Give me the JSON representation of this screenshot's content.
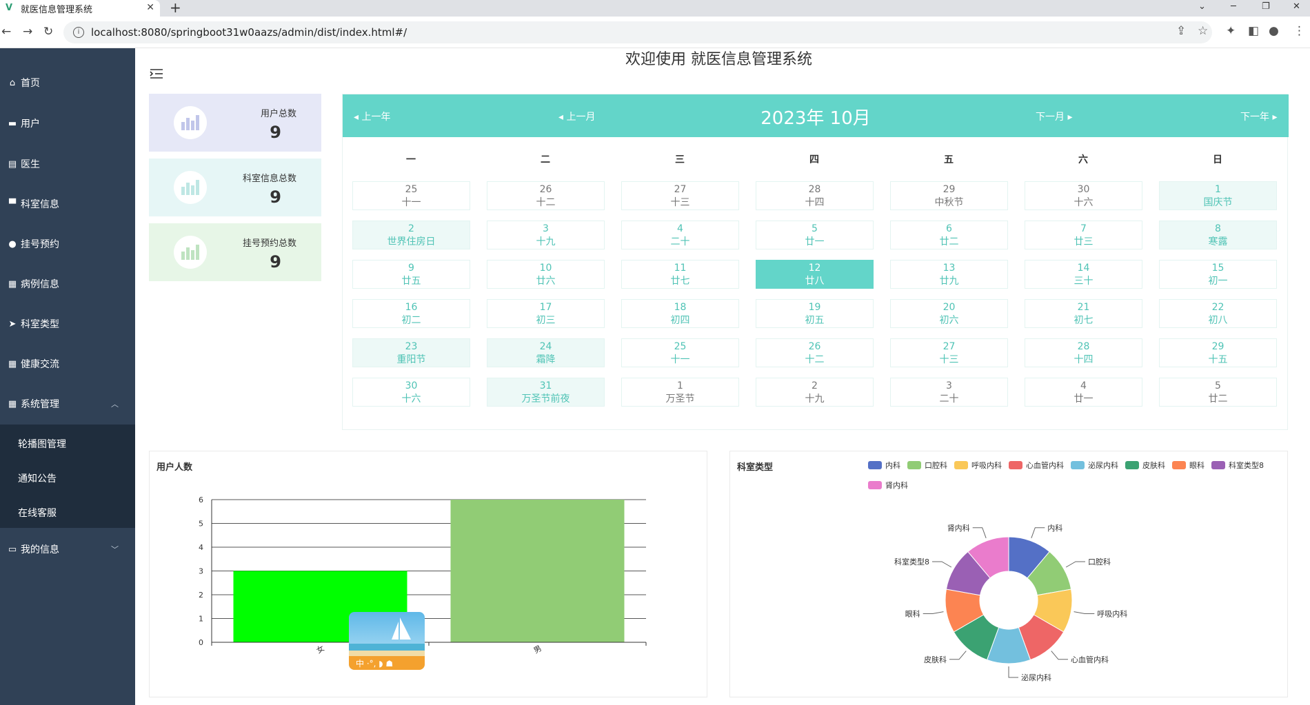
{
  "browser": {
    "tab_title": "就医信息管理系统",
    "url": "localhost:8080/springboot31w0aazs/admin/dist/index.html#/"
  },
  "header": {
    "title": "欢迎使用 就医信息管理系统"
  },
  "sidebar": {
    "items": [
      {
        "label": "首页",
        "icon": "home-icon"
      },
      {
        "label": "用户",
        "icon": "user-icon"
      },
      {
        "label": "医生",
        "icon": "doctor-icon"
      },
      {
        "label": "科室信息",
        "icon": "monitor-icon"
      },
      {
        "label": "挂号预约",
        "icon": "location-icon"
      },
      {
        "label": "病例信息",
        "icon": "grid-icon"
      },
      {
        "label": "科室类型",
        "icon": "send-icon"
      },
      {
        "label": "健康交流",
        "icon": "grid-icon"
      },
      {
        "label": "系统管理",
        "icon": "grid-icon"
      }
    ],
    "submenu": [
      "轮播图管理",
      "通知公告",
      "在线客服"
    ],
    "last_item": {
      "label": "我的信息",
      "icon": "profile-icon"
    }
  },
  "stats": [
    {
      "label": "用户总数",
      "value": "9",
      "bg": "#e6e8f7",
      "icon_color": "#c1c6ea"
    },
    {
      "label": "科室信息总数",
      "value": "9",
      "bg": "#e6f6f6",
      "icon_color": "#bfe7e4"
    },
    {
      "label": "挂号预约总数",
      "value": "9",
      "bg": "#e7f6e7",
      "icon_color": "#bfe3c1"
    }
  ],
  "calendar": {
    "title": "2023年 10月",
    "prev_year": "上一年",
    "prev_month": "上一月",
    "next_month": "下一月",
    "next_year": "下一年",
    "weekdays": [
      "一",
      "二",
      "三",
      "四",
      "五",
      "六",
      "日"
    ],
    "days": [
      {
        "d": "25",
        "l": "十一",
        "other": true
      },
      {
        "d": "26",
        "l": "十二",
        "other": true
      },
      {
        "d": "27",
        "l": "十三",
        "other": true
      },
      {
        "d": "28",
        "l": "十四",
        "other": true
      },
      {
        "d": "29",
        "l": "中秋节",
        "other": true
      },
      {
        "d": "30",
        "l": "十六",
        "other": true
      },
      {
        "d": "1",
        "l": "国庆节",
        "hl": true
      },
      {
        "d": "2",
        "l": "世界住房日",
        "hl": true
      },
      {
        "d": "3",
        "l": "十九"
      },
      {
        "d": "4",
        "l": "二十"
      },
      {
        "d": "5",
        "l": "廿一"
      },
      {
        "d": "6",
        "l": "廿二"
      },
      {
        "d": "7",
        "l": "廿三"
      },
      {
        "d": "8",
        "l": "寒露",
        "hl": true
      },
      {
        "d": "9",
        "l": "廿五"
      },
      {
        "d": "10",
        "l": "廿六"
      },
      {
        "d": "11",
        "l": "廿七"
      },
      {
        "d": "12",
        "l": "廿八",
        "today": true
      },
      {
        "d": "13",
        "l": "廿九"
      },
      {
        "d": "14",
        "l": "三十"
      },
      {
        "d": "15",
        "l": "初一"
      },
      {
        "d": "16",
        "l": "初二"
      },
      {
        "d": "17",
        "l": "初三"
      },
      {
        "d": "18",
        "l": "初四"
      },
      {
        "d": "19",
        "l": "初五"
      },
      {
        "d": "20",
        "l": "初六"
      },
      {
        "d": "21",
        "l": "初七"
      },
      {
        "d": "22",
        "l": "初八"
      },
      {
        "d": "23",
        "l": "重阳节",
        "hl": true
      },
      {
        "d": "24",
        "l": "霜降",
        "hl": true
      },
      {
        "d": "25",
        "l": "十一"
      },
      {
        "d": "26",
        "l": "十二"
      },
      {
        "d": "27",
        "l": "十三"
      },
      {
        "d": "28",
        "l": "十四"
      },
      {
        "d": "29",
        "l": "十五"
      },
      {
        "d": "30",
        "l": "十六"
      },
      {
        "d": "31",
        "l": "万圣节前夜",
        "hl": true
      },
      {
        "d": "1",
        "l": "万圣节",
        "other": true
      },
      {
        "d": "2",
        "l": "十九",
        "other": true
      },
      {
        "d": "3",
        "l": "二十",
        "other": true
      },
      {
        "d": "4",
        "l": "廿一",
        "other": true
      },
      {
        "d": "5",
        "l": "廿二",
        "other": true
      }
    ]
  },
  "chart_data": [
    {
      "type": "bar",
      "title": "用户人数",
      "categories": [
        "女",
        "男"
      ],
      "values": [
        3,
        6
      ],
      "colors": [
        "#00ff00",
        "#91cc75"
      ],
      "ylim": [
        0,
        6
      ],
      "yticks": [
        "0",
        "1",
        "2",
        "3",
        "4",
        "5",
        "6"
      ],
      "grid": true
    },
    {
      "type": "pie",
      "title": "科室类型",
      "donut": true,
      "legend_position": "top-right",
      "categories": [
        "内科",
        "口腔科",
        "呼吸内科",
        "心血管内科",
        "泌尿内科",
        "皮肤科",
        "眼科",
        "科室类型8",
        "肾内科"
      ],
      "values": [
        1,
        1,
        1,
        1,
        1,
        1,
        1,
        1,
        1
      ],
      "colors": [
        "#5470c6",
        "#91cc75",
        "#fac858",
        "#ee6666",
        "#73c0de",
        "#3ba272",
        "#fc8452",
        "#9a60b4",
        "#ea7ccc"
      ]
    }
  ]
}
